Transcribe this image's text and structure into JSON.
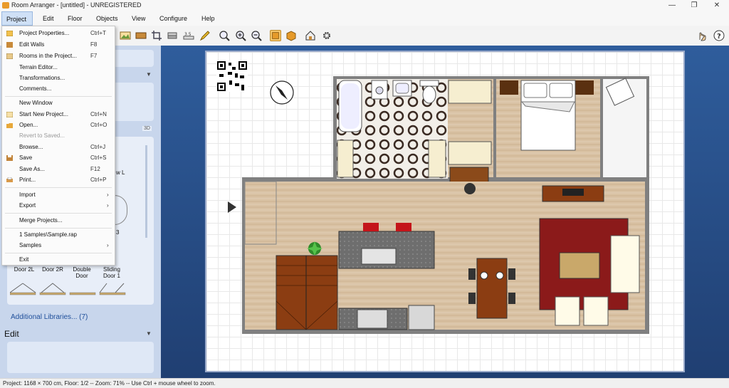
{
  "window": {
    "title": "Room Arranger - [untitled] - UNREGISTERED"
  },
  "menubar": {
    "items": [
      "Project",
      "Edit",
      "Floor",
      "Objects",
      "View",
      "Configure",
      "Help"
    ]
  },
  "project_menu": {
    "items": [
      {
        "label": "Project Properties...",
        "shortcut": "Ctrl+T",
        "icon": "project-properties-icon"
      },
      {
        "label": "Edit Walls",
        "shortcut": "F8",
        "icon": "walls-icon"
      },
      {
        "label": "Rooms in the Project...",
        "shortcut": "F7",
        "icon": "rooms-icon"
      },
      {
        "label": "Terrain Editor...",
        "shortcut": ""
      },
      {
        "label": "Transformations...",
        "shortcut": ""
      },
      {
        "label": "Comments...",
        "shortcut": ""
      },
      {
        "label": "New Window",
        "shortcut": ""
      },
      {
        "label": "Start New Project...",
        "shortcut": "Ctrl+N",
        "icon": "new-project-icon"
      },
      {
        "label": "Open...",
        "shortcut": "Ctrl+O",
        "icon": "open-folder-icon"
      },
      {
        "label": "Revert to Saved...",
        "shortcut": ""
      },
      {
        "label": "Browse...",
        "shortcut": "Ctrl+J"
      },
      {
        "label": "Save",
        "shortcut": "Ctrl+S",
        "icon": "save-icon"
      },
      {
        "label": "Save As...",
        "shortcut": "F12"
      },
      {
        "label": "Print...",
        "shortcut": "Ctrl+P",
        "icon": "print-icon"
      },
      {
        "label": "Import",
        "shortcut": ""
      },
      {
        "label": "Export",
        "shortcut": ""
      },
      {
        "label": "Merge Projects...",
        "shortcut": ""
      },
      {
        "label": "1 Samples\\Sample.rap",
        "shortcut": ""
      },
      {
        "label": "Samples",
        "shortcut": ""
      },
      {
        "label": "Exit",
        "shortcut": ""
      }
    ],
    "submenu_arrow": "›"
  },
  "left_panel": {
    "view_3d": "3D",
    "partial_label_1": "w L",
    "partial_label_2": "3",
    "doors": [
      "Door 2L",
      "Door 2R",
      "Double Door",
      "Sliding Door 1"
    ],
    "additional_libraries": "Additional Libraries... (7)",
    "edit_title": "Edit",
    "collapse_arrow": "▼"
  },
  "status": {
    "text": "Project: 1168 × 700 cm, Floor: 1/2 -- Zoom: 71% -- Use Ctrl + mouse wheel to zoom."
  },
  "colors": {
    "accent": "#f5c56a",
    "canvas": "#2f5d9c",
    "panel": "#c8d6ec",
    "menu_highlight": "#cfe0f6"
  }
}
